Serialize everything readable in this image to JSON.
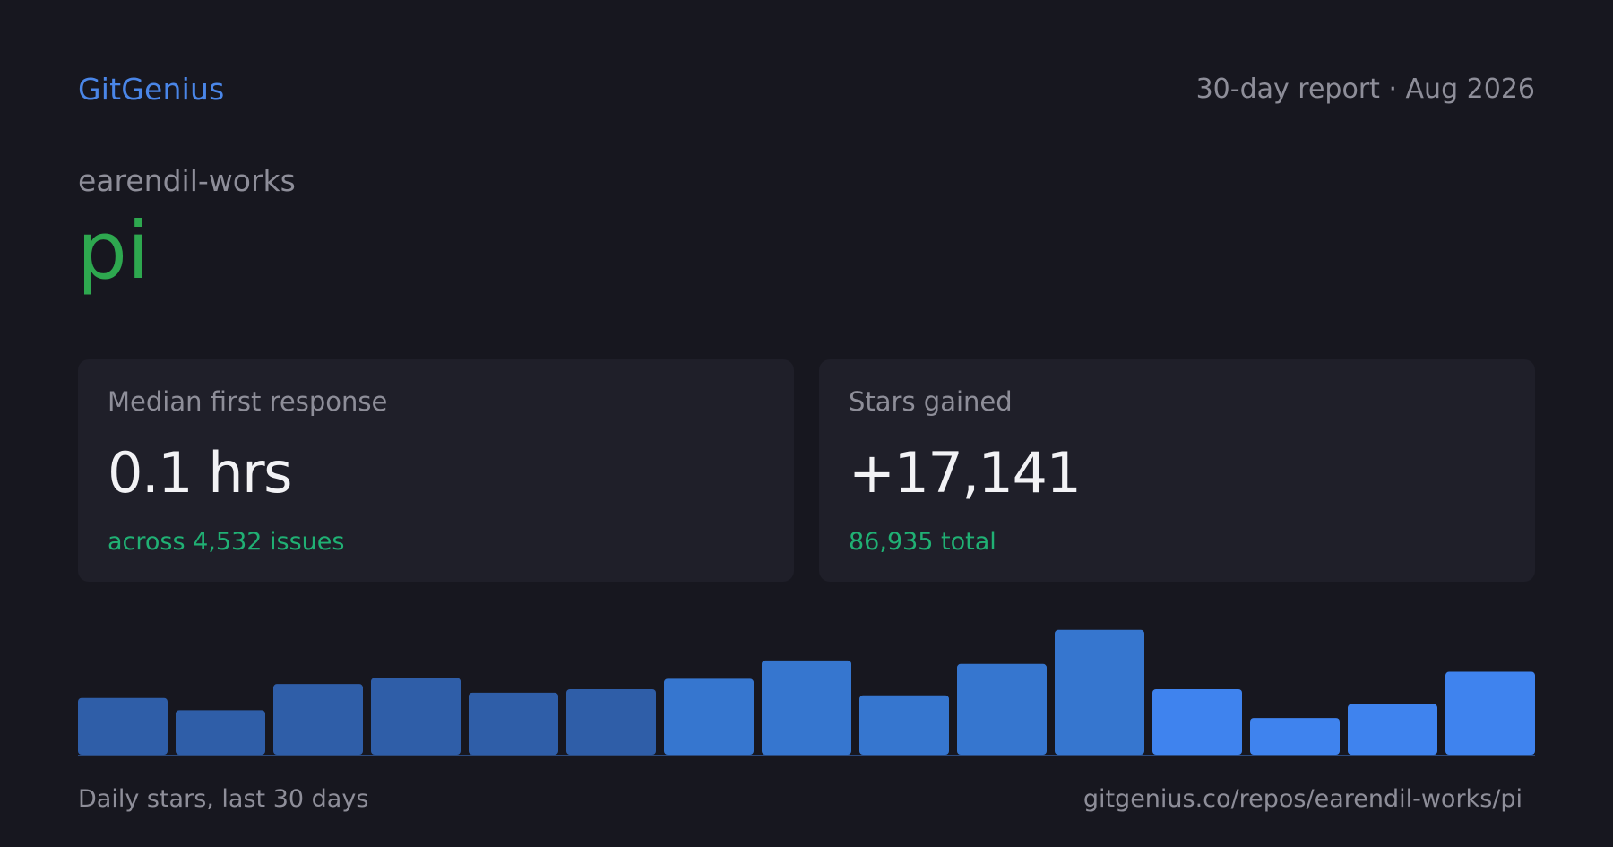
{
  "header": {
    "brand": "GitGenius",
    "report_label": "30-day report · Aug 2026"
  },
  "repo": {
    "owner": "earendil-works",
    "name": "pi"
  },
  "cards": [
    {
      "label": "Median first response",
      "value": "0.1 hrs",
      "sub": "across 4,532 issues"
    },
    {
      "label": "Stars gained",
      "value": "+17,141",
      "sub": "86,935 total"
    }
  ],
  "colors": {
    "accent": "#4a86e8",
    "repo": "#2ea84f",
    "positive": "#20b074",
    "background": "#17171f"
  },
  "chart_data": {
    "type": "bar",
    "title": "",
    "xlabel": "",
    "ylabel": "",
    "values": [
      65,
      51,
      81,
      88,
      71,
      75,
      87,
      108,
      68,
      104,
      143,
      75,
      42,
      58,
      95
    ],
    "bar_colors": [
      "#2f5ea8",
      "#2f5ea8",
      "#2f5ea8",
      "#2f5ea8",
      "#2f5ea8",
      "#2f5ea8",
      "#3676cf",
      "#3676cf",
      "#3676cf",
      "#3676cf",
      "#3676cf",
      "#3f83ee",
      "#3f83ee",
      "#3f83ee",
      "#3f83ee"
    ],
    "ylim": [
      0,
      150
    ],
    "grid": false,
    "legend": "none"
  },
  "footer": {
    "caption": "Daily stars, last 30 days",
    "url": "gitgenius.co/repos/earendil-works/pi"
  }
}
